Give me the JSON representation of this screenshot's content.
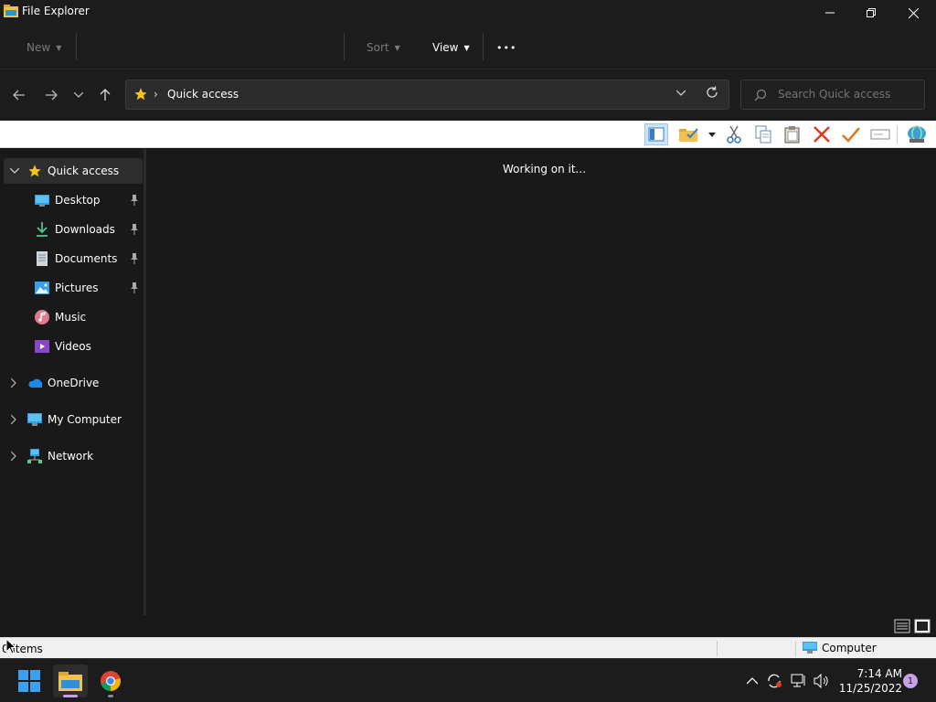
{
  "window": {
    "title": "File Explorer"
  },
  "command_bar": {
    "new_label": "New",
    "sort_label": "Sort",
    "view_label": "View",
    "more_label": "•••"
  },
  "address": {
    "path": "Quick access",
    "separator": "›"
  },
  "search": {
    "placeholder": "Search Quick access"
  },
  "sidebar": {
    "quick_access": "Quick access",
    "items": [
      {
        "label": "Desktop",
        "icon": "desktop-icon",
        "pinned": true
      },
      {
        "label": "Downloads",
        "icon": "downloads-icon",
        "pinned": true
      },
      {
        "label": "Documents",
        "icon": "documents-icon",
        "pinned": true
      },
      {
        "label": "Pictures",
        "icon": "pictures-icon",
        "pinned": true
      },
      {
        "label": "Music",
        "icon": "music-icon",
        "pinned": false
      },
      {
        "label": "Videos",
        "icon": "videos-icon",
        "pinned": false
      }
    ],
    "onedrive": "OneDrive",
    "my_computer": "My Computer",
    "network": "Network"
  },
  "content": {
    "status_message": "Working on it..."
  },
  "statusbar": {
    "items": "0 items",
    "computer": "Computer"
  },
  "taskbar": {
    "time": "7:14 AM",
    "date": "11/25/2022",
    "notifications": "1"
  },
  "colors": {
    "accent": "#0078d4",
    "star": "#f5c518",
    "delete": "#e03c1c",
    "check": "#e07a1c"
  }
}
